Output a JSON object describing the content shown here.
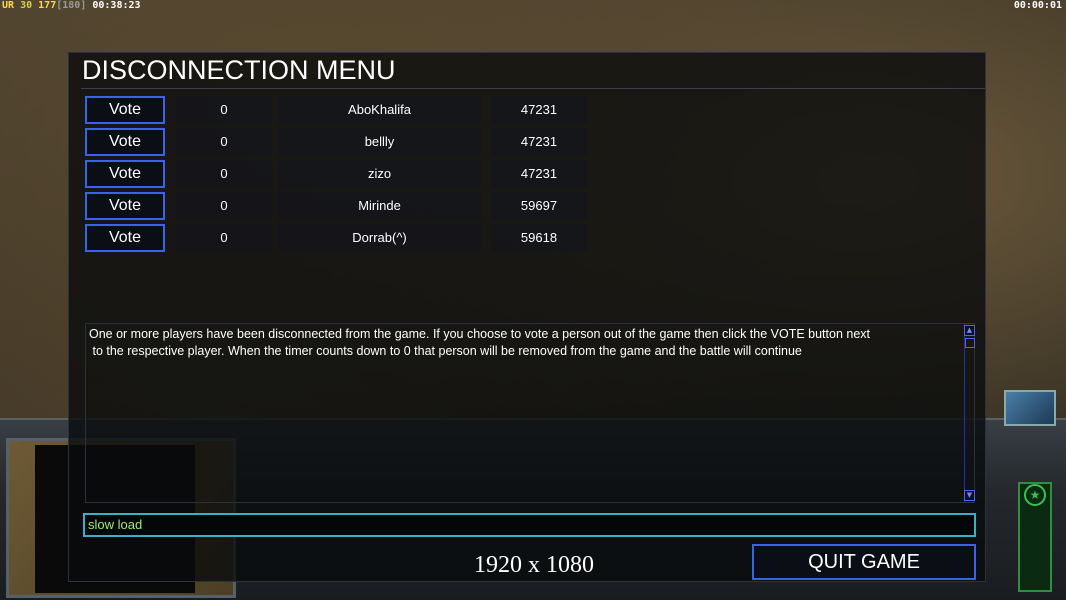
{
  "topbar": {
    "faction": "UR",
    "count_a": "30",
    "count_b": "177",
    "count_c": "[180]",
    "elapsed": "00:38:23",
    "timer": "00:00:01"
  },
  "dialog": {
    "title": "DISCONNECTION MENU",
    "players": [
      {
        "vote_label": "Vote",
        "votes": "0",
        "name": "AboKhalifa",
        "ping": "47231"
      },
      {
        "vote_label": "Vote",
        "votes": "0",
        "name": "bellly",
        "ping": "47231"
      },
      {
        "vote_label": "Vote",
        "votes": "0",
        "name": "zizo",
        "ping": "47231"
      },
      {
        "vote_label": "Vote",
        "votes": "0",
        "name": "Mirinde",
        "ping": "59697"
      },
      {
        "vote_label": "Vote",
        "votes": "0",
        "name": "Dorrab(^)",
        "ping": "59618"
      }
    ],
    "message_line1": "One or more players have been disconnected from the game. If you choose to vote a person out of the game then click the VOTE button next",
    "message_line2": " to the respective player. When the timer counts down to 0 that person will be removed from the game and the battle will continue",
    "chat_value": "slow load",
    "resolution": "1920 x 1080",
    "quit_label": "QUIT GAME"
  },
  "icons": {
    "scroll_up": "scroll-up-icon",
    "scroll_down": "scroll-down-icon",
    "radar": "star-icon",
    "satellite": "satellite-icon"
  },
  "colors": {
    "button_border": "#3a64e8",
    "chat_border": "#3ab0c8",
    "chat_text": "#9cef6a",
    "faction": "#ffd84a"
  }
}
